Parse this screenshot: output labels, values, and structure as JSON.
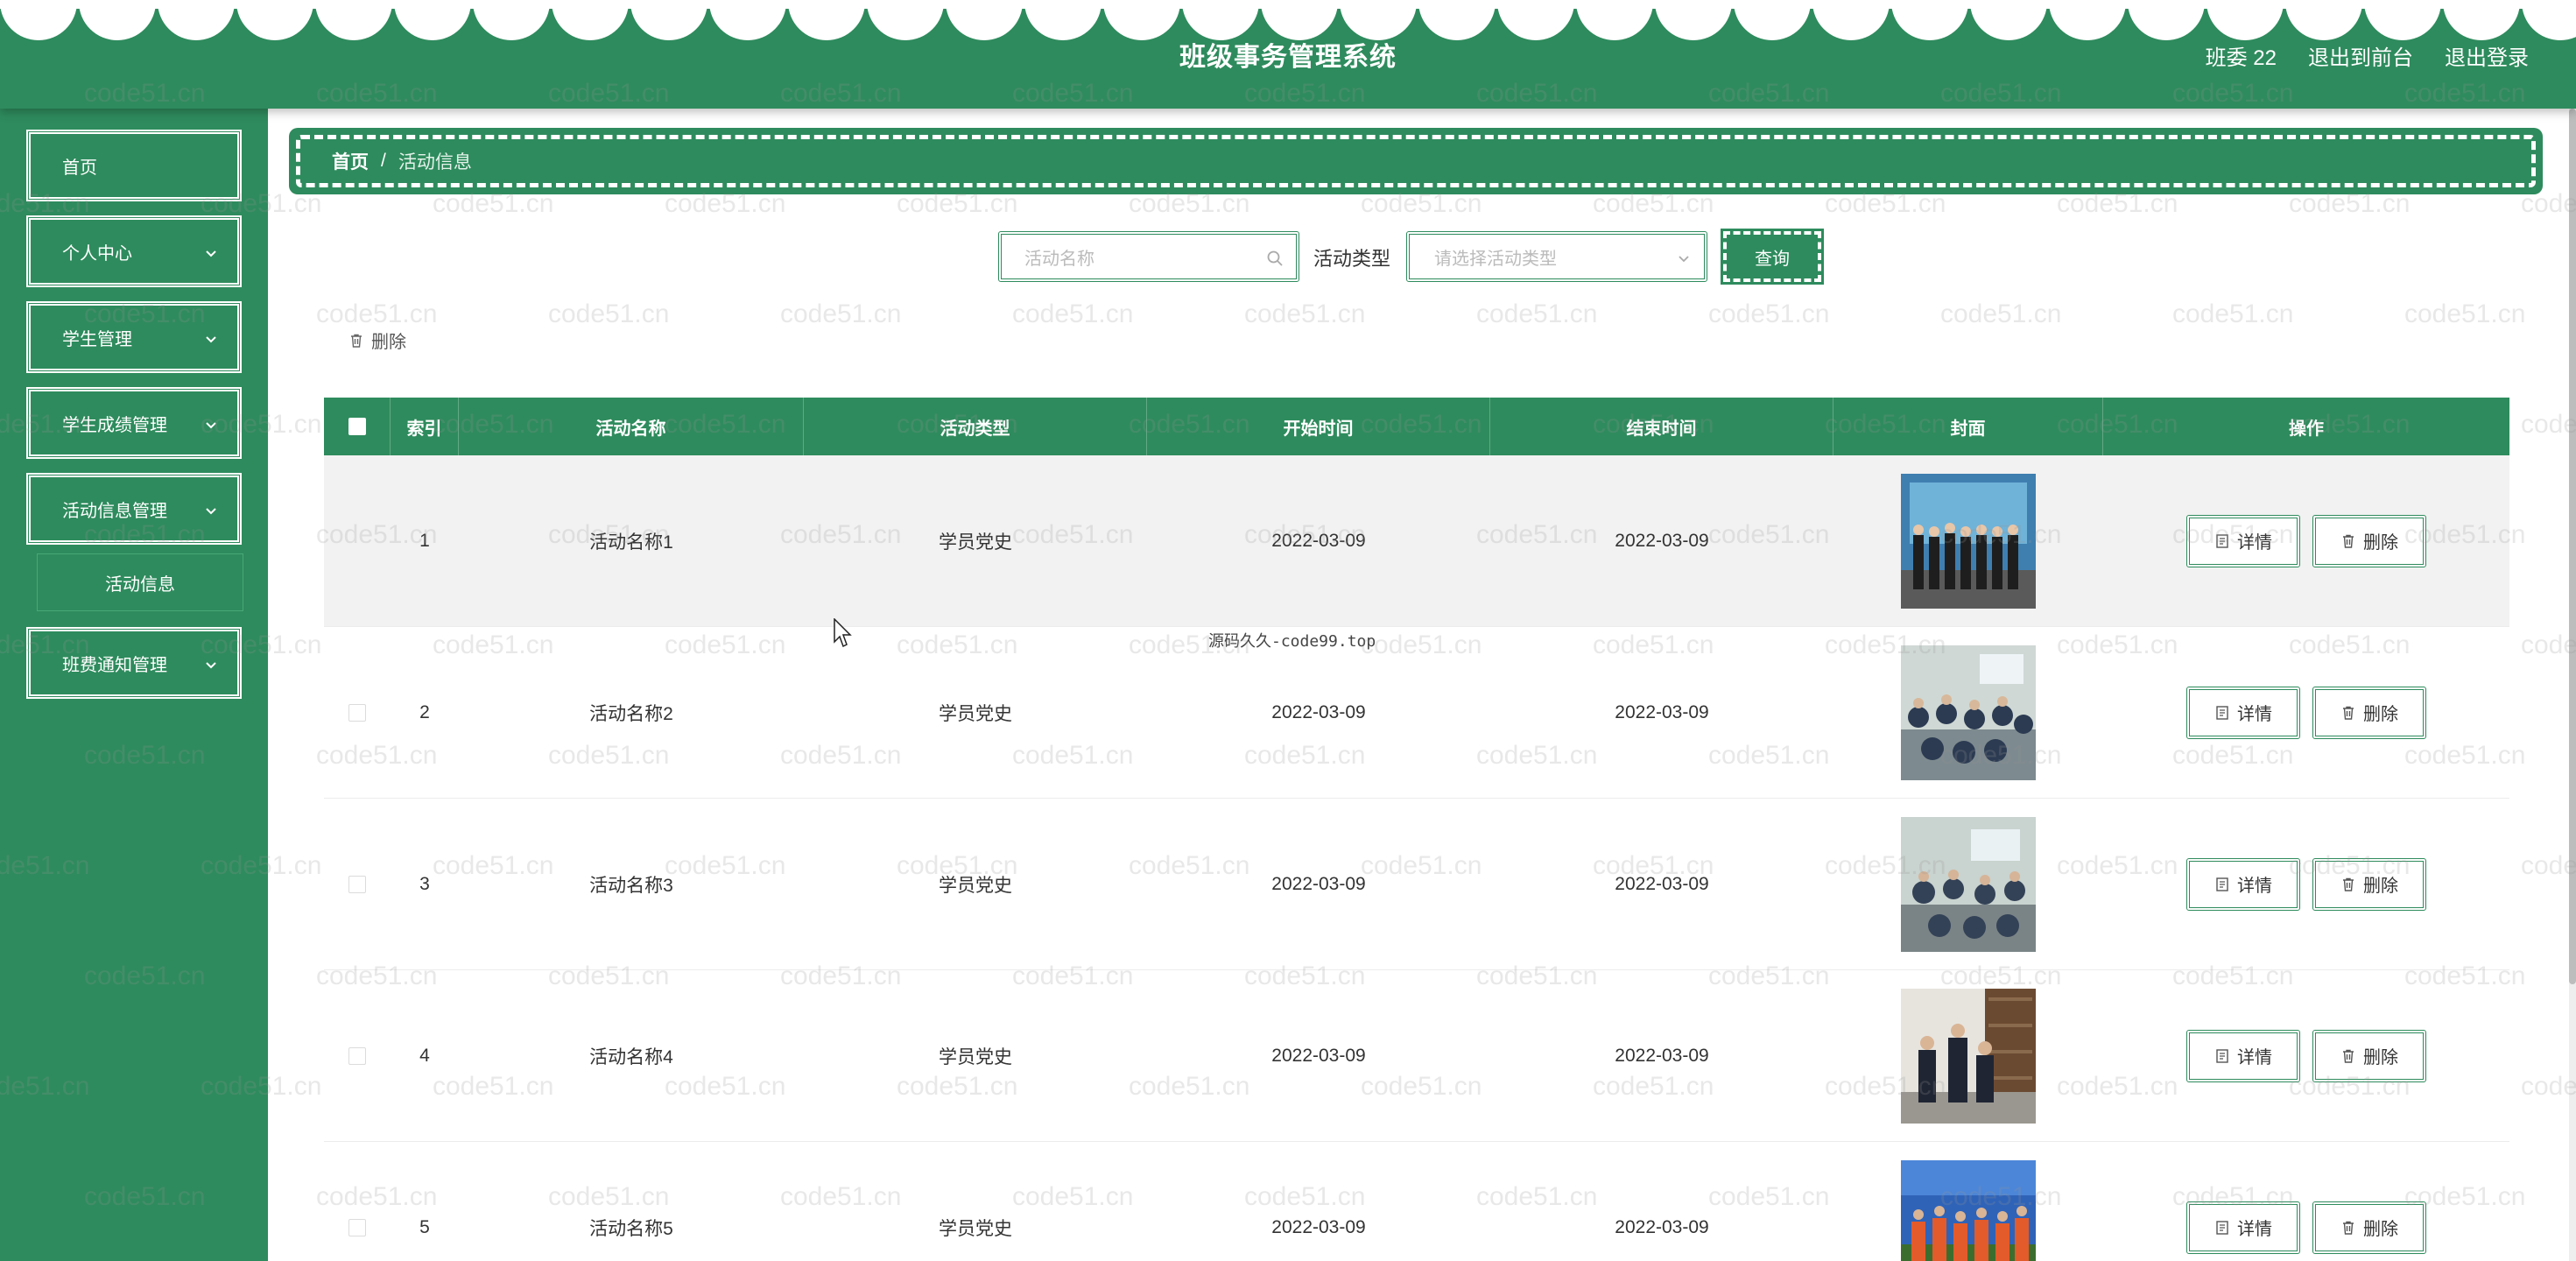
{
  "header": {
    "title": "班级事务管理系统",
    "user_label": "班委 22",
    "back_to_front_label": "退出到前台",
    "logout_label": "退出登录"
  },
  "sidebar": {
    "items": [
      {
        "label": "首页",
        "has_arrow": false
      },
      {
        "label": "个人中心",
        "has_arrow": true
      },
      {
        "label": "学生管理",
        "has_arrow": true
      },
      {
        "label": "学生成绩管理",
        "has_arrow": true
      },
      {
        "label": "活动信息管理",
        "has_arrow": true
      },
      {
        "label": "班费通知管理",
        "has_arrow": true
      }
    ],
    "submenu": {
      "label": "活动信息"
    }
  },
  "breadcrumb": {
    "home": "首页",
    "separator": "/",
    "current": "活动信息"
  },
  "search": {
    "name_placeholder": "活动名称",
    "type_label": "活动类型",
    "type_placeholder": "请选择活动类型",
    "query_label": "查询"
  },
  "toolbar": {
    "delete_label": "删除"
  },
  "table": {
    "columns": [
      "索引",
      "活动名称",
      "活动类型",
      "开始时间",
      "结束时间",
      "封面",
      "操作"
    ],
    "detail_label": "详情",
    "delete_label": "删除",
    "rows": [
      {
        "index": "1",
        "name": "活动名称1",
        "type": "学员党史",
        "start": "2022-03-09",
        "end": "2022-03-09"
      },
      {
        "index": "2",
        "name": "活动名称2",
        "type": "学员党史",
        "start": "2022-03-09",
        "end": "2022-03-09"
      },
      {
        "index": "3",
        "name": "活动名称3",
        "type": "学员党史",
        "start": "2022-03-09",
        "end": "2022-03-09"
      },
      {
        "index": "4",
        "name": "活动名称4",
        "type": "学员党史",
        "start": "2022-03-09",
        "end": "2022-03-09"
      },
      {
        "index": "5",
        "name": "活动名称5",
        "type": "学员党史",
        "start": "2022-03-09",
        "end": "2022-03-09"
      }
    ]
  },
  "overlay": {
    "site_mark": "源码久久-code99.top",
    "watermark": "code51.cn"
  },
  "colors": {
    "primary": "#2e8b5d",
    "white": "#ffffff",
    "row_highlight": "#f2f2f2"
  }
}
